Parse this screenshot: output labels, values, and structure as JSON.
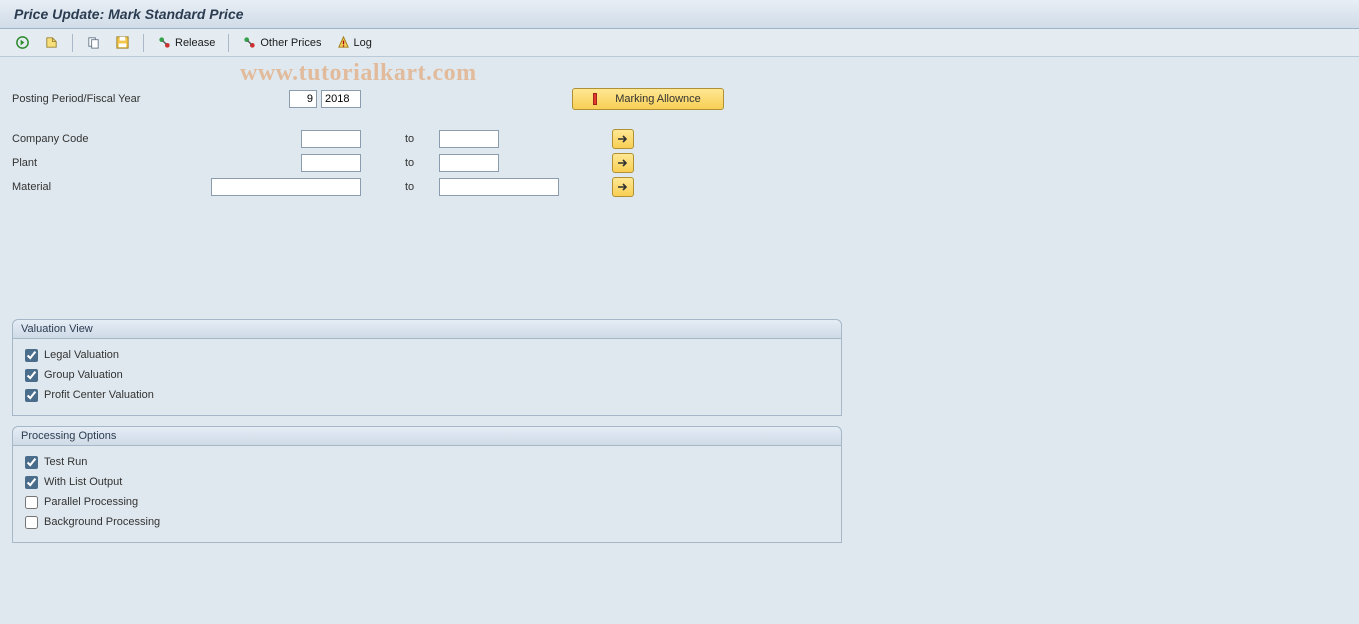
{
  "header": {
    "title": "Price Update: Mark Standard Price"
  },
  "toolbar": {
    "release": "Release",
    "other_prices": "Other Prices",
    "log": "Log"
  },
  "watermark": "www.tutorialkart.com",
  "form": {
    "posting_label": "Posting Period/Fiscal Year",
    "posting_period": "9",
    "fiscal_year": "2018",
    "marking_allow_label": "Marking Allownce",
    "company_code_label": "Company Code",
    "plant_label": "Plant",
    "material_label": "Material",
    "to_label": "to",
    "company_code_from": "",
    "company_code_to": "",
    "plant_from": "",
    "plant_to": "",
    "material_from": "",
    "material_to": ""
  },
  "groups": {
    "valuation_title": "Valuation View",
    "legal_valuation": "Legal Valuation",
    "group_valuation": "Group Valuation",
    "profit_center_valuation": "Profit Center Valuation",
    "processing_title": "Processing Options",
    "test_run": "Test Run",
    "with_list_output": "With List Output",
    "parallel_processing": "Parallel Processing",
    "background_processing": "Background Processing"
  }
}
